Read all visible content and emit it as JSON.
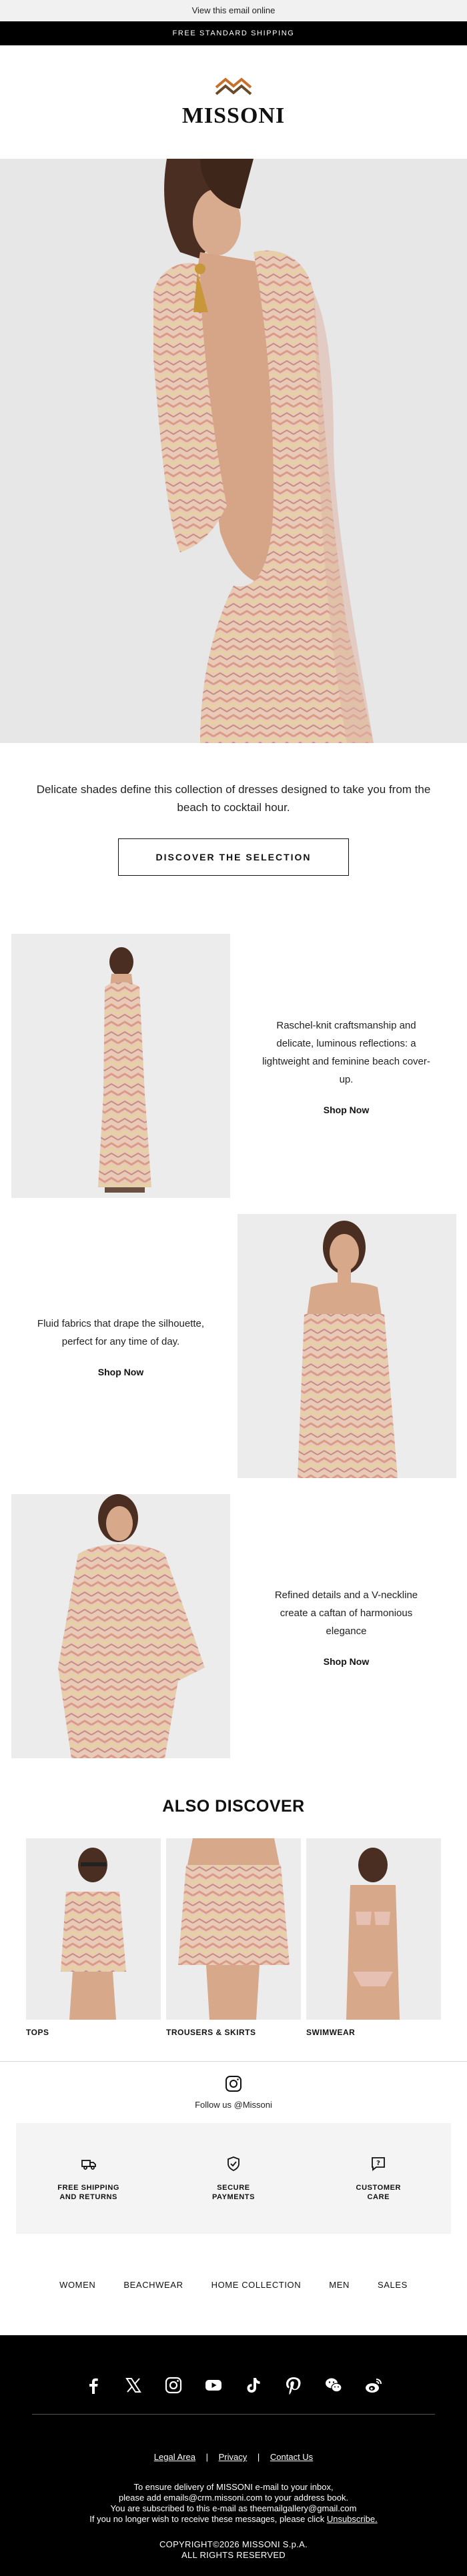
{
  "preheader": {
    "view_online": "View this email online"
  },
  "topbar": {
    "text": "FREE STANDARD SHIPPING"
  },
  "brand": {
    "logo_text": "MISSONI",
    "colors": {
      "black": "#000000",
      "accent": "#c8702a"
    }
  },
  "hero": {
    "image": "hero-model-backless-knit-dress"
  },
  "intro": {
    "text": "Delicate shades define this collection of dresses designed to take you from the beach to cocktail hour.",
    "cta_label": "DISCOVER THE SELECTION"
  },
  "features": [
    {
      "text": "Raschel-knit craftsmanship and delicate, luminous reflections: a lightweight and feminine beach cover-up.",
      "link": "Shop Now"
    },
    {
      "text": "Fluid fabrics that drape the silhouette, perfect for any time of day.",
      "link": "Shop Now"
    },
    {
      "text": "Refined details and a V-neckline create a caftan of harmonious elegance",
      "link": "Shop Now"
    }
  ],
  "also_discover": {
    "title": "ALSO DISCOVER",
    "items": [
      {
        "label": "TOPS"
      },
      {
        "label": "TROUSERS & SKIRTS"
      },
      {
        "label": "SWIMWEAR"
      }
    ]
  },
  "follow": {
    "text": "Follow us @Missoni"
  },
  "services": [
    {
      "icon": "truck-icon",
      "label_line1": "FREE SHIPPING",
      "label_line2": "AND RETURNS"
    },
    {
      "icon": "shield-check-icon",
      "label_line1": "SECURE",
      "label_line2": "PAYMENTS"
    },
    {
      "icon": "chat-question-icon",
      "label_line1": "CUSTOMER",
      "label_line2": "CARE"
    }
  ],
  "nav": [
    "WOMEN",
    "BEACHWEAR",
    "HOME COLLECTION",
    "MEN",
    "SALES"
  ],
  "footer": {
    "socials": [
      "facebook-icon",
      "x-icon",
      "instagram-icon",
      "youtube-icon",
      "tiktok-icon",
      "pinterest-icon",
      "wechat-icon",
      "weibo-icon"
    ],
    "links": [
      "Legal Area",
      "Privacy",
      "Contact Us"
    ],
    "separator": "|",
    "notice_1": "To ensure delivery of MISSONI e-mail to your inbox,",
    "notice_2": "please add emails@crm.missoni.com to your address book.",
    "notice_3": "You are subscribed to this e-mail as theemailgallery@gmail.com",
    "notice_4_prefix": "If you no longer wish to receive these messages, please click",
    "notice_4_link": "Unsubscribe.",
    "copyright_1": "COPYRIGHT©2026 MISSONI S.p.A.",
    "copyright_2": "ALL RIGHTS RESERVED"
  }
}
